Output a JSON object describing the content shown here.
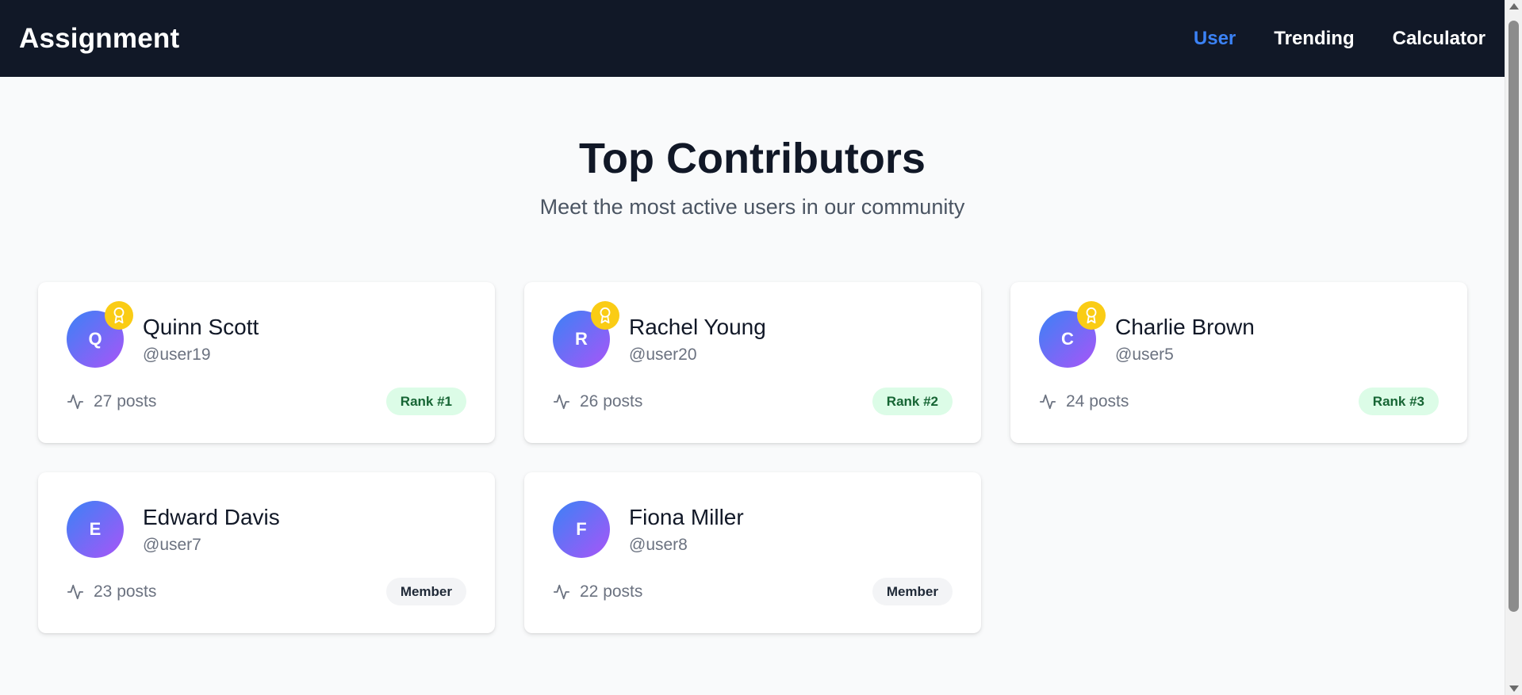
{
  "nav": {
    "brand": "Assignment",
    "links": [
      {
        "label": "User",
        "active": true
      },
      {
        "label": "Trending",
        "active": false
      },
      {
        "label": "Calculator",
        "active": false
      }
    ]
  },
  "hero": {
    "title": "Top Contributors",
    "subtitle": "Meet the most active users in our community"
  },
  "contributors": [
    {
      "initial": "Q",
      "name": "Quinn Scott",
      "handle": "@user19",
      "posts": "27 posts",
      "badge": "Rank #1",
      "badge_type": "rank",
      "award": true
    },
    {
      "initial": "R",
      "name": "Rachel Young",
      "handle": "@user20",
      "posts": "26 posts",
      "badge": "Rank #2",
      "badge_type": "rank",
      "award": true
    },
    {
      "initial": "C",
      "name": "Charlie Brown",
      "handle": "@user5",
      "posts": "24 posts",
      "badge": "Rank #3",
      "badge_type": "rank",
      "award": true
    },
    {
      "initial": "E",
      "name": "Edward Davis",
      "handle": "@user7",
      "posts": "23 posts",
      "badge": "Member",
      "badge_type": "member",
      "award": false
    },
    {
      "initial": "F",
      "name": "Fiona Miller",
      "handle": "@user8",
      "posts": "22 posts",
      "badge": "Member",
      "badge_type": "member",
      "award": false
    }
  ],
  "icons": {
    "award": "award-icon",
    "activity": "activity-icon"
  },
  "colors": {
    "nav_bg": "#111827",
    "nav_active": "#3b82f6",
    "avatar_gradient_start": "#3b82f6",
    "avatar_gradient_end": "#a855f7",
    "award_bg": "#facc15",
    "rank_bg": "#dcfce7",
    "rank_text": "#166534",
    "member_bg": "#f3f4f6"
  }
}
